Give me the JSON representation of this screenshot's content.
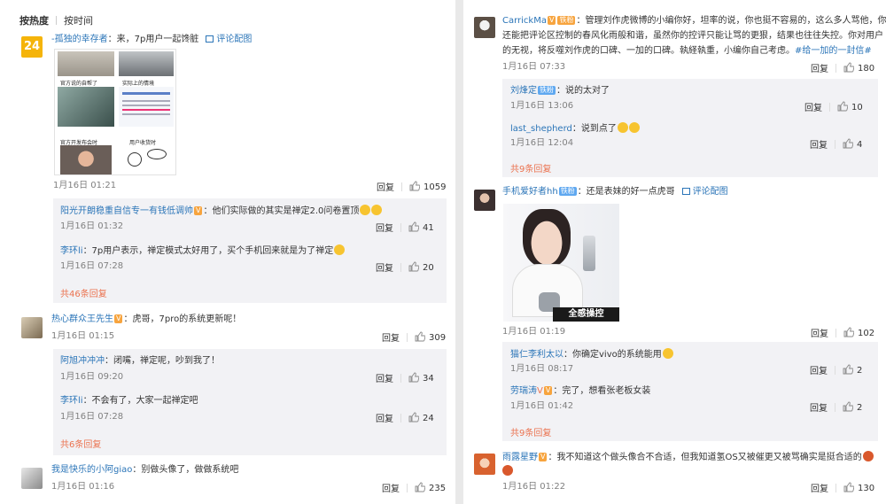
{
  "tabs": {
    "hot": "按热度",
    "time": "按时间"
  },
  "left": {
    "c1": {
      "avatar_text": "24",
      "name": "-孤独的幸存者",
      "text": "：来，7p用户一起馋脏",
      "pic_link": "评论配图",
      "time": "1月16日 01:21",
      "reply": "回复",
      "likes": "1059",
      "image": {
        "cap1": "官方说的自帮了",
        "cap2": "实际上的情境",
        "cap3": "官方开发布会时",
        "cap4": "用户收货时"
      },
      "replies": [
        {
          "name": "阳光开朗稳重自信专一有钱低调帅",
          "text": "：他们实际做的其实是禅定2.0问卷置顶",
          "time": "1月16日 01:32",
          "reply": "回复",
          "likes": "41"
        },
        {
          "name": "李环li",
          "text": "：7p用户表示，禅定模式太好用了，买个手机回来就是为了禅定",
          "time": "1月16日 07:28",
          "reply": "回复",
          "likes": "20"
        }
      ],
      "more": "共46条回复"
    },
    "c2": {
      "name": "热心群众王先生",
      "text": "：虎哥，7pro的系统更新呢！",
      "time": "1月16日 01:15",
      "reply": "回复",
      "likes": "309",
      "replies": [
        {
          "name": "阿旭冲冲冲",
          "text": "：闭嘴，禅定呢，吵到我了！",
          "time": "1月16日 09:20",
          "reply": "回复",
          "likes": "34"
        },
        {
          "name": "李环li",
          "text": "：不会有了，大家一起禅定吧",
          "time": "1月16日 07:28",
          "reply": "回复",
          "likes": "24"
        }
      ],
      "more": "共6条回复"
    },
    "c3": {
      "name": "我是快乐的小阿giao",
      "text": "：别做头像了，做做系统吧",
      "time": "1月16日 01:16",
      "reply": "回复",
      "likes": "235"
    }
  },
  "right": {
    "c1": {
      "name": "CarrickMa",
      "badge": "铁粉",
      "text1": "：管理刘作虎微博的小编你好，坦率的说，你也挺不容易的，这么多人骂他，你",
      "text2": "还能把评论区控制的春风化雨般和谐，虽然你的控评只能让骂的更狠，结果也往往失控。你对用户",
      "text3": "的无视，将反噬刘作虎的口碑、一加的口碑。執経執重，小编你自己考虑。",
      "hashtag": "#给一加的一封信#",
      "time": "1月16日 07:33",
      "reply": "回复",
      "likes": "180",
      "replies": [
        {
          "name": "刘烽定",
          "badge": "铁粉",
          "text": "：说的太对了",
          "time": "1月16日 13:06",
          "reply": "回复",
          "likes": "10"
        },
        {
          "name": "last_shepherd",
          "text": "：说到点了",
          "time": "1月16日 12:04",
          "reply": "回复",
          "likes": "4"
        }
      ],
      "more": "共9条回复"
    },
    "c2": {
      "name": "手机爱好者hh",
      "badge": "铁粉",
      "text": "：还是表妹的好一点虎哥",
      "pic_link": "评论配图",
      "image_caption": "全感操控",
      "time": "1月16日 01:19",
      "reply": "回复",
      "likes": "102",
      "replies": [
        {
          "name": "猫仁李利太以",
          "text": "：你确定vivo的系统能用",
          "time": "1月16日 08:17",
          "reply": "回复",
          "likes": "2"
        },
        {
          "name": "劳瑞涛",
          "text": "：完了，想看张老板女装",
          "time": "1月16日 01:42",
          "reply": "回复",
          "likes": "2"
        }
      ],
      "more": "共9条回复"
    },
    "c3": {
      "name": "雨露星野",
      "text": "：我不知道这个做头像合不合适，但我知道氢OS又被催更又被骂确实是挺合适的",
      "time": "1月16日 01:22",
      "reply": "回复",
      "likes": "130"
    }
  },
  "colors": {
    "name_orange": "#eb7350",
    "link_blue": "#2b75b8",
    "reply_bg": "#f2f2f5",
    "meta_gray": "#808080"
  }
}
